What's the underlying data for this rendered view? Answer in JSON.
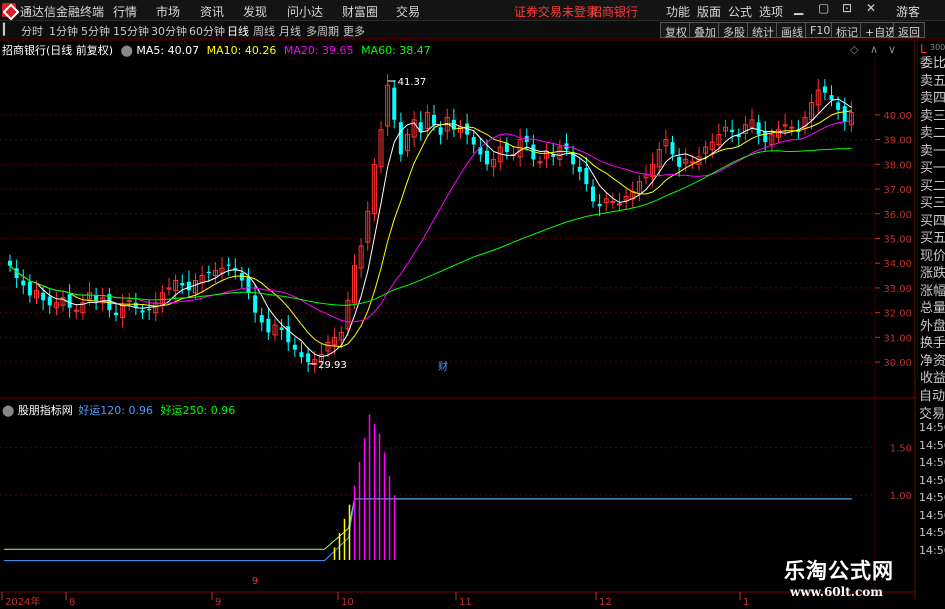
{
  "menubar": {
    "app_title": "通达信金融终端",
    "items": [
      "行情",
      "市场",
      "资讯",
      "发现",
      "问小达",
      "财富圈",
      "交易"
    ],
    "login_notice": "证券交易未登录",
    "broker": "招商银行",
    "right_items": [
      "功能",
      "版面",
      "公式",
      "选项"
    ],
    "guest": "游客"
  },
  "periodbar": {
    "periods": [
      "分时",
      "1分钟",
      "5分钟",
      "15分钟",
      "30分钟",
      "60分钟",
      "日线",
      "周线",
      "月线",
      "多周期",
      "更多"
    ],
    "active": "日线",
    "tools": [
      "复权",
      "叠加",
      "多股",
      "统计",
      "画线",
      "F10",
      "标记",
      "+自选",
      "返回"
    ]
  },
  "main_chart": {
    "stock_title": "招商银行(日线 前复权)",
    "ma5_label": "MA5: 40.07",
    "ma10_label": "MA10: 40.26",
    "ma20_label": "MA20: 39.65",
    "ma60_label": "MA60: 38.47",
    "high_label": "41.37",
    "low_label": "29.93",
    "finance_marker": "财",
    "colors": {
      "up": "#ff3232",
      "down": "#00ffff",
      "ma5": "#ffffff",
      "ma10": "#ffff00",
      "ma20": "#ff00ff",
      "ma60": "#00ff00",
      "axis": "#c03030"
    }
  },
  "right_panel": {
    "items": [
      "委比",
      "卖五",
      "卖四",
      "卖三",
      "卖二",
      "卖一",
      "买一",
      "买二",
      "买三",
      "买四",
      "买五",
      "现价",
      "涨跌",
      "涨幅",
      "总量",
      "外盘",
      "换手",
      "净资",
      "收益"
    ],
    "badge": "L",
    "badge_sub": "300"
  },
  "sub_chart": {
    "indicator_name": "股朋指标网",
    "label1": "好运120: 0.96",
    "label2": "好运250: 0.96",
    "right_items": [
      "自动",
      "交易",
      "14:56",
      "14:56",
      "14:56",
      "14:56",
      "14:56",
      "14:56",
      "14:56",
      "14:56"
    ]
  },
  "time_axis": {
    "labels": [
      "2024年",
      "8",
      "9",
      "10",
      "11",
      "12",
      "1"
    ],
    "marker": "9"
  },
  "watermark": {
    "line1": "乐淘公式网",
    "line2": "www.60lt.com"
  },
  "chart_data": [
    {
      "type": "candlestick",
      "title": "招商银行(日线 前复权)",
      "y_ticks": [
        30.0,
        31.0,
        32.0,
        33.0,
        34.0,
        35.0,
        36.0,
        37.0,
        38.0,
        39.0,
        40.0
      ],
      "ylim": [
        29.6,
        42.3
      ],
      "x_tick_labels": [
        "2024年",
        "8",
        "9",
        "10",
        "11",
        "12",
        "1"
      ],
      "closes": [
        33.9,
        33.4,
        33.1,
        32.7,
        32.9,
        32.5,
        32.3,
        32.4,
        32.6,
        32.2,
        32.1,
        32.4,
        32.8,
        32.5,
        32.6,
        32.1,
        31.9,
        32.3,
        32.5,
        32.2,
        32.0,
        32.1,
        32.4,
        32.8,
        33.0,
        33.3,
        33.1,
        32.9,
        33.3,
        33.5,
        33.6,
        33.7,
        33.8,
        33.9,
        33.7,
        33.3,
        32.8,
        32.0,
        31.6,
        31.2,
        31.5,
        31.3,
        30.8,
        30.5,
        30.2,
        30.0,
        30.1,
        30.3,
        30.8,
        31.0,
        31.2,
        32.5,
        33.9,
        34.7,
        36.1,
        38.0,
        39.4,
        41.2,
        39.8,
        38.4,
        39.2,
        39.8,
        39.3,
        40.1,
        39.6,
        39.2,
        39.9,
        39.4,
        39.5,
        39.2,
        38.8,
        38.4,
        38.0,
        38.2,
        38.7,
        38.5,
        38.4,
        39.0,
        38.9,
        38.2,
        38.1,
        38.5,
        38.3,
        38.7,
        38.6,
        38.0,
        37.7,
        37.2,
        36.5,
        36.3,
        36.6,
        36.5,
        36.4,
        36.7,
        36.9,
        37.3,
        37.6,
        38.0,
        38.6,
        39.0,
        38.4,
        37.9,
        38.2,
        38.1,
        38.3,
        38.7,
        38.9,
        39.2,
        39.5,
        39.3,
        39.1,
        39.6,
        39.8,
        39.2,
        38.9,
        39.2,
        39.4,
        39.6,
        39.5,
        39.3,
        39.9,
        40.5,
        41.0,
        40.9,
        40.6,
        40.2,
        39.7,
        40.1
      ],
      "ma_series": [
        {
          "name": "MA5",
          "last": 40.07
        },
        {
          "name": "MA10",
          "last": 40.26
        },
        {
          "name": "MA20",
          "last": 39.65
        },
        {
          "name": "MA60",
          "last": 38.47
        }
      ],
      "high": 41.37,
      "low": 29.93
    },
    {
      "type": "line",
      "title": "股朋指标网",
      "y_ticks": [
        1.0,
        1.5
      ],
      "ylim": [
        0.0,
        1.95
      ],
      "series": [
        {
          "name": "好运120",
          "last": 0.96
        },
        {
          "name": "好运250",
          "last": 0.96
        }
      ]
    }
  ]
}
